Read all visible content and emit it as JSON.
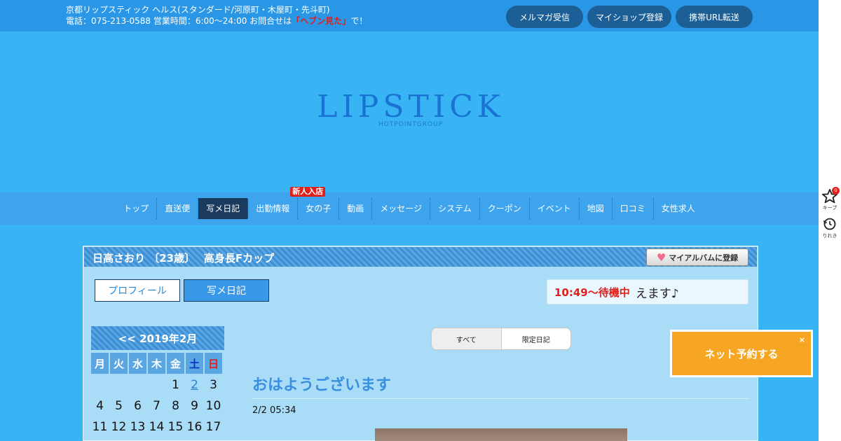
{
  "header": {
    "line1": "京都リップスティック ヘルス(スタンダード/河原町・木屋町・先斗町)",
    "line2_prefix": "電話：075-213-0588 営業時間：6:00～24:00 お問合せは",
    "line2_highlight": "「ヘブン見た」",
    "line2_suffix": "で！",
    "buttons": [
      "メルマガ受信",
      "マイショップ登録",
      "携帯URL転送"
    ]
  },
  "logo": {
    "main": "LIPSTICK",
    "sub": "HOTPOINTGROUP"
  },
  "nav": {
    "items": [
      "トップ",
      "直送便",
      "写メ日記",
      "出勤情報",
      "女の子",
      "動画",
      "メッセージ",
      "システム",
      "クーポン",
      "イベント",
      "地図",
      "口コミ",
      "女性求人"
    ],
    "active": "写メ日記",
    "badge": "新人入店"
  },
  "profile": {
    "title": "日高さおり 〔23歳〕　 高身長Fカップ",
    "album_button": "マイアルバムに登録",
    "tab_profile": "プロフィール",
    "tab_diary": "写メ日記",
    "status_time": "10:49～待機中",
    "status_msg": "えます♪"
  },
  "calendar": {
    "header": "<< 2019年2月",
    "weekdays": [
      "月",
      "火",
      "水",
      "木",
      "金",
      "土",
      "日"
    ],
    "row1": [
      "",
      "",
      "",
      "",
      "1",
      "2",
      "3"
    ],
    "row2": [
      "4",
      "5",
      "6",
      "7",
      "8",
      "9",
      "10"
    ],
    "row3": [
      "11",
      "12",
      "13",
      "14",
      "15",
      "16",
      "17"
    ]
  },
  "filter": {
    "all": "すべて",
    "limited": "限定日記"
  },
  "post": {
    "title": "おはようございます",
    "date": "2/2 05:34"
  },
  "reserve": {
    "label": "ネット予約する",
    "close": "×"
  },
  "sidebar": {
    "keep_label": "キープ",
    "keep_count": "0",
    "history_label": "りれき"
  },
  "colors": {
    "background": "#38b4f4",
    "topbar": "#2a96e6",
    "nav_active": "#1a3a5e",
    "reserve": "#f6a623",
    "accent_red": "#e0201a"
  }
}
